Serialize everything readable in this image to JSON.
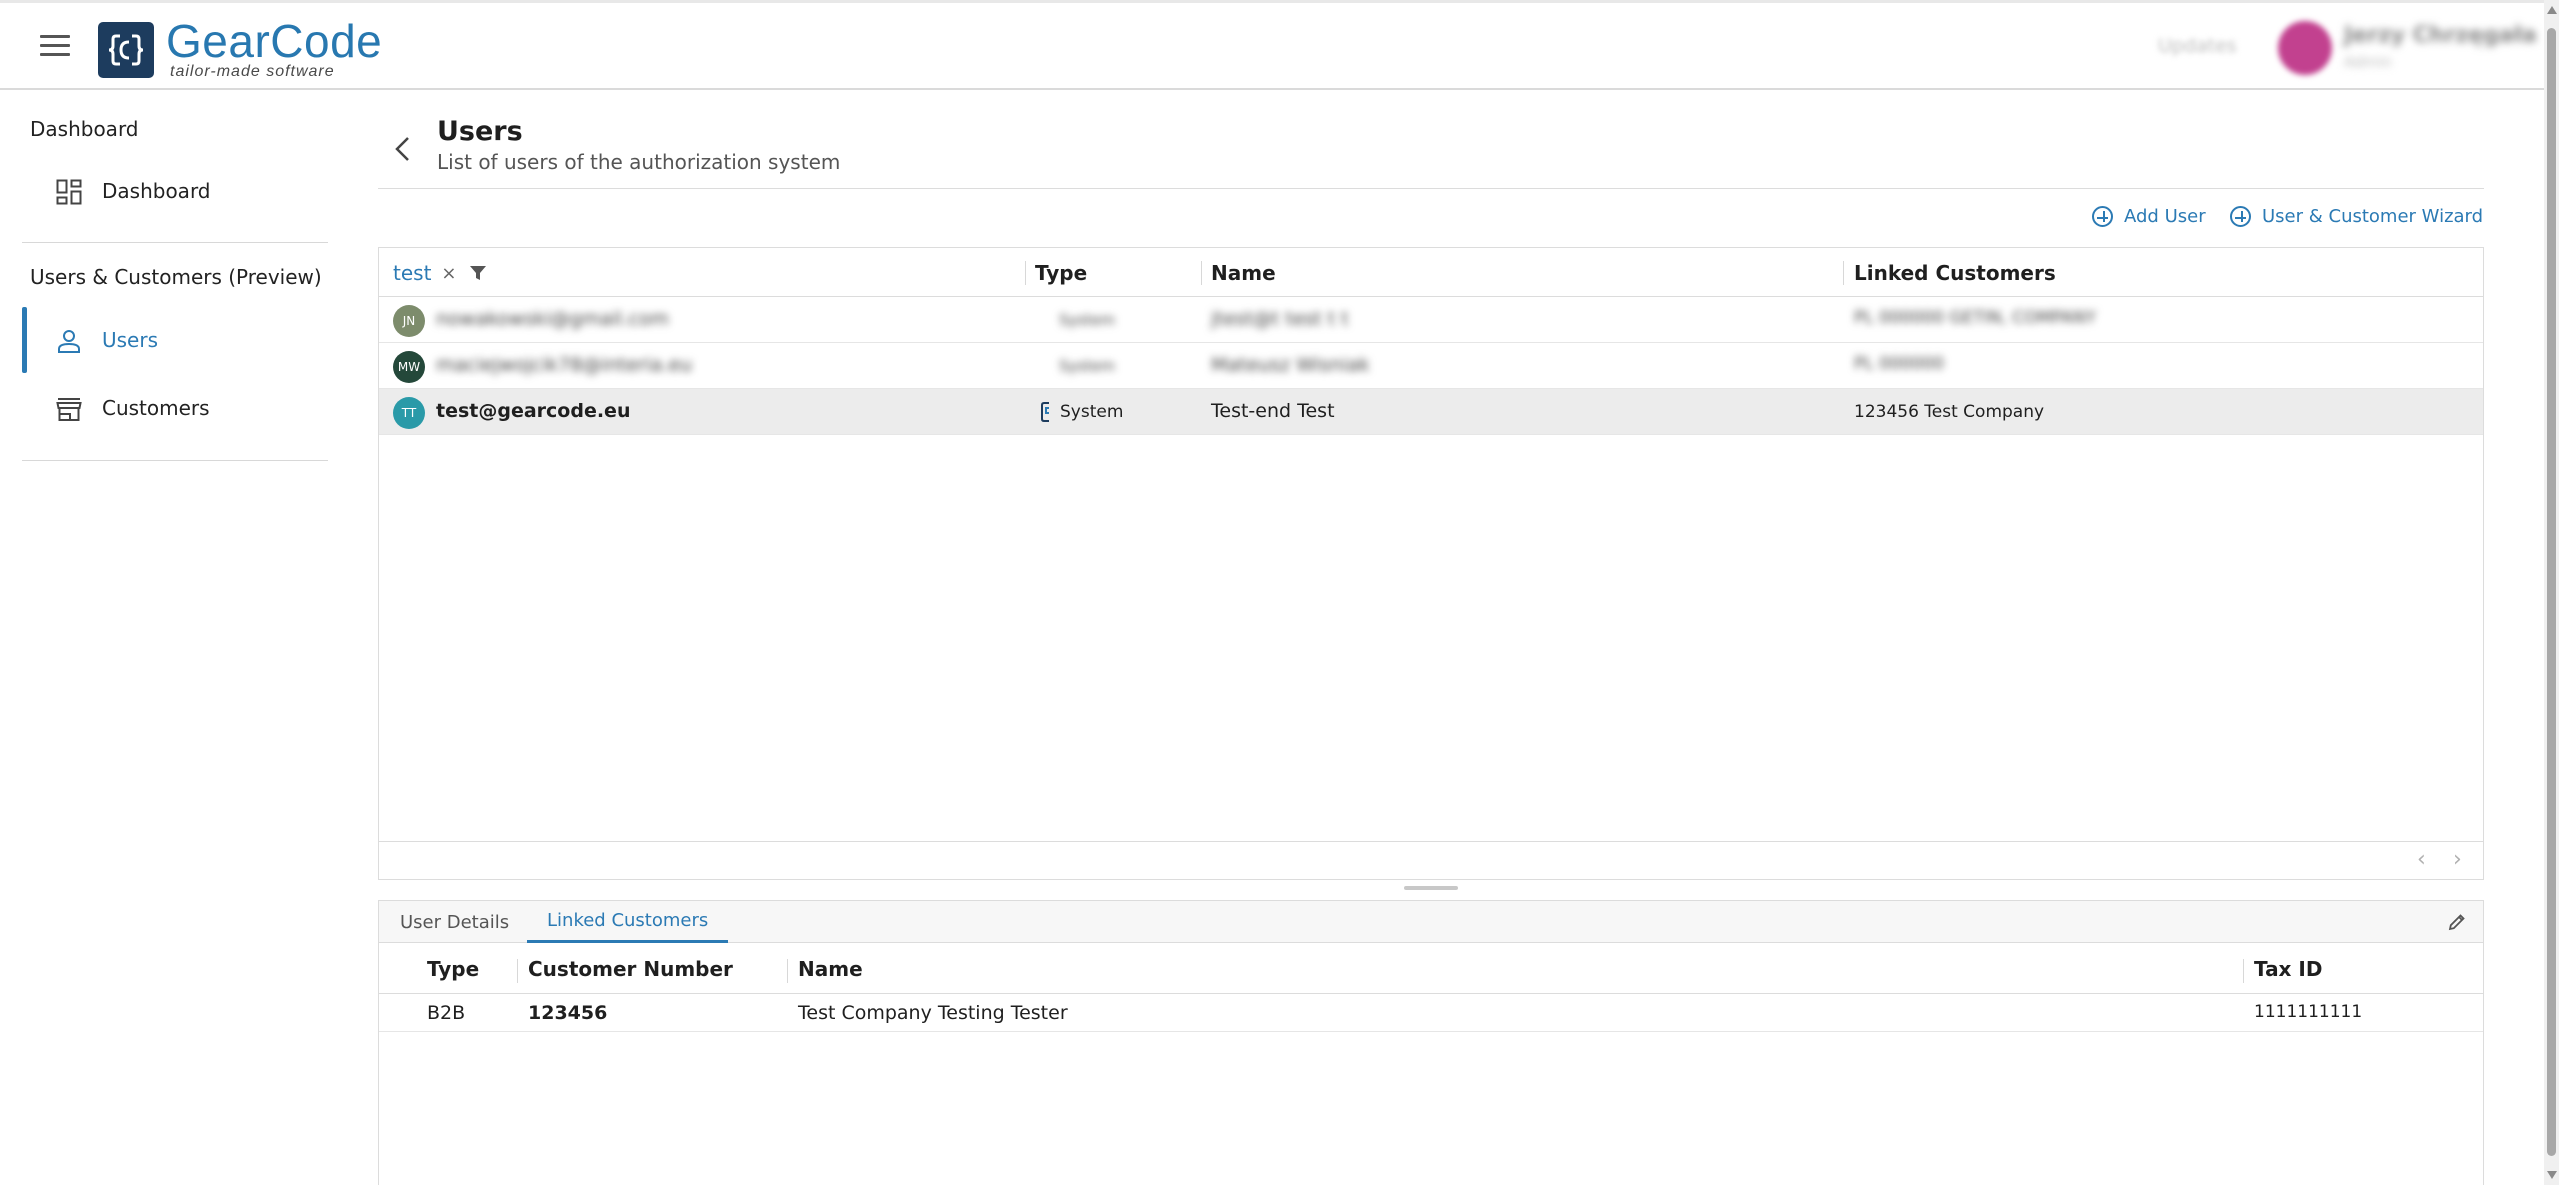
{
  "app": {
    "logo_name": "GearCode",
    "logo_tagline": "tailor-made software",
    "header_link": "Updates",
    "user_name": "Jerzy Chrzęgała",
    "user_role": "Admin"
  },
  "sidebar": {
    "section1_title": "Dashboard",
    "dashboard_label": "Dashboard",
    "section2_title": "Users & Customers (Preview)",
    "users_label": "Users",
    "customers_label": "Customers"
  },
  "page": {
    "title": "Users",
    "subtitle": "List of users of the authorization system"
  },
  "actions": {
    "add_user": "Add User",
    "wizard": "User & Customer Wizard"
  },
  "grid": {
    "filter_value": "test",
    "filter_clear": "×",
    "columns": {
      "type": "Type",
      "name": "Name",
      "linked": "Linked Customers"
    },
    "rows": [
      {
        "initials": "JN",
        "email": "nowakowski@gmail.com",
        "type": "System",
        "name": "jtest@t test t t",
        "linked": "PL 000000 GETIN, COMPANY",
        "avatar_color": "#7d8c6c"
      },
      {
        "initials": "MW",
        "email": "maciejwojcik78@interia.eu",
        "type": "System",
        "name": "Mateusz Wisniak",
        "linked": "PL 000000",
        "avatar_color": "#24483a"
      },
      {
        "initials": "TT",
        "email": "test@gearcode.eu",
        "type": "System",
        "name": "Test-end Test",
        "linked": "123456 Test Company",
        "avatar_color": "#2a9aa8"
      }
    ],
    "prev": "‹",
    "next": "›"
  },
  "detail": {
    "tabs": [
      "User Details",
      "Linked Customers"
    ],
    "active_tab": 1,
    "columns": {
      "type": "Type",
      "number": "Customer Number",
      "name": "Name",
      "tax": "Tax ID"
    },
    "rows": [
      {
        "type": "B2B",
        "number": "123456",
        "name": "Test Company Testing Tester",
        "tax": "1111111111"
      }
    ]
  },
  "colors": {
    "accent": "#2b7ab4",
    "brand_dark": "#1d3c5e"
  }
}
